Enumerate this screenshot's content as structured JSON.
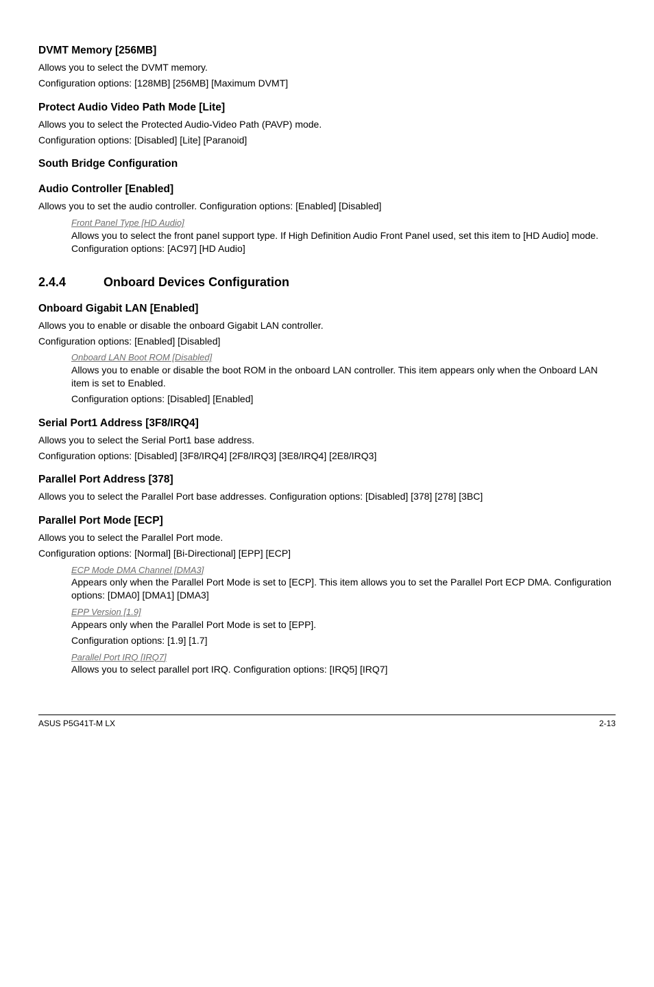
{
  "items": [
    {
      "title": "DVMT Memory [256MB]",
      "body": [
        "Allows you to select the DVMT memory.",
        "Configuration options: [128MB] [256MB] [Maximum DVMT]"
      ]
    },
    {
      "title": "Protect Audio Video Path Mode [Lite]",
      "body": [
        "Allows you to select the Protected Audio-Video Path (PAVP) mode.",
        "Configuration options: [Disabled] [Lite] [Paranoid]"
      ]
    },
    {
      "title": "South Bridge Configuration",
      "body": []
    },
    {
      "title": "Audio Controller [Enabled]",
      "body": [
        "Allows you to set the audio controller. Configuration options: [Enabled] [Disabled]"
      ],
      "sub": [
        {
          "head": "Front Panel Type [HD Audio]",
          "text": "Allows you to select the front panel support type. If High Definition Audio Front Panel used, set this item to [HD Audio] mode. Configuration options: [AC97] [HD Audio]"
        }
      ]
    }
  ],
  "section": {
    "num": "2.4.4",
    "title": "Onboard Devices Configuration"
  },
  "items2": [
    {
      "title": "Onboard Gigabit LAN [Enabled]",
      "body": [
        "Allows you to enable or disable the onboard Gigabit LAN controller.",
        "Configuration options: [Enabled] [Disabled]"
      ],
      "sub": [
        {
          "head": "Onboard LAN Boot ROM [Disabled]",
          "text": "Allows you to enable or disable the boot ROM in the onboard LAN controller. This item appears only when the Onboard LAN item is set to Enabled.",
          "text2": "Configuration options: [Disabled] [Enabled]"
        }
      ]
    },
    {
      "title": "Serial Port1 Address [3F8/IRQ4]",
      "body": [
        "Allows you to select the Serial Port1 base address.",
        "Configuration options: [Disabled] [3F8/IRQ4] [2F8/IRQ3] [3E8/IRQ4] [2E8/IRQ3]"
      ]
    },
    {
      "title": "Parallel Port Address [378]",
      "body": [
        "Allows you to select the Parallel Port base addresses. Configuration options: [Disabled] [378] [278] [3BC]"
      ]
    },
    {
      "title": "Parallel Port Mode [ECP]",
      "body": [
        "Allows you to select the Parallel Port mode.",
        "Configuration options: [Normal] [Bi-Directional] [EPP] [ECP]"
      ],
      "sub": [
        {
          "head": "ECP Mode DMA Channel [DMA3]",
          "text": "Appears only when the Parallel Port Mode is set to [ECP]. This item allows you to set the Parallel Port ECP DMA. Configuration options: [DMA0] [DMA1] [DMA3]"
        },
        {
          "head": "EPP Version [1.9]",
          "text": "Appears only when the Parallel Port Mode is set to [EPP].",
          "text2": "Configuration options: [1.9] [1.7]"
        },
        {
          "head": "Parallel Port IRQ [IRQ7]",
          "text": "Allows you to select parallel port IRQ. Configuration options: [IRQ5] [IRQ7]"
        }
      ]
    }
  ],
  "footer": {
    "left": "ASUS P5G41T-M LX",
    "right": "2-13"
  }
}
